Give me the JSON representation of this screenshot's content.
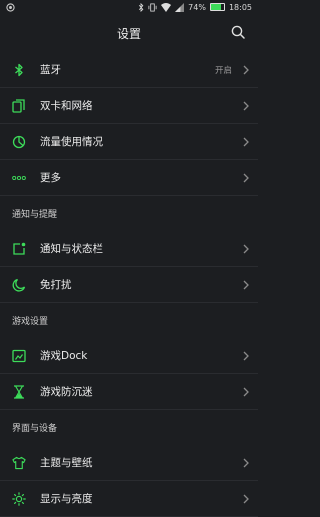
{
  "statusbar": {
    "battery": "74%",
    "time": "18:05",
    "battery_level": 0.74
  },
  "header": {
    "title": "设置"
  },
  "groups": [
    {
      "items": [
        {
          "label": "蓝牙",
          "value": "开启",
          "icon": "bluetooth-icon"
        },
        {
          "label": "双卡和网络",
          "icon": "sim-cards-icon"
        },
        {
          "label": "流量使用情况",
          "icon": "data-usage-icon"
        },
        {
          "label": "更多",
          "icon": "more-dots-icon"
        }
      ]
    },
    {
      "section": "通知与提醒",
      "items": [
        {
          "label": "通知与状态栏",
          "icon": "notification-icon"
        },
        {
          "label": "免打扰",
          "icon": "moon-icon"
        }
      ]
    },
    {
      "section": "游戏设置",
      "items": [
        {
          "label": "游戏Dock",
          "icon": "game-dock-icon"
        },
        {
          "label": "游戏防沉迷",
          "icon": "hourglass-icon"
        }
      ]
    },
    {
      "section": "界面与设备",
      "items": [
        {
          "label": "主题与壁纸",
          "icon": "tshirt-icon"
        },
        {
          "label": "显示与亮度",
          "icon": "brightness-icon"
        }
      ]
    }
  ],
  "colors": {
    "accent": "#3ddc5a",
    "background": "#1c1e21"
  }
}
